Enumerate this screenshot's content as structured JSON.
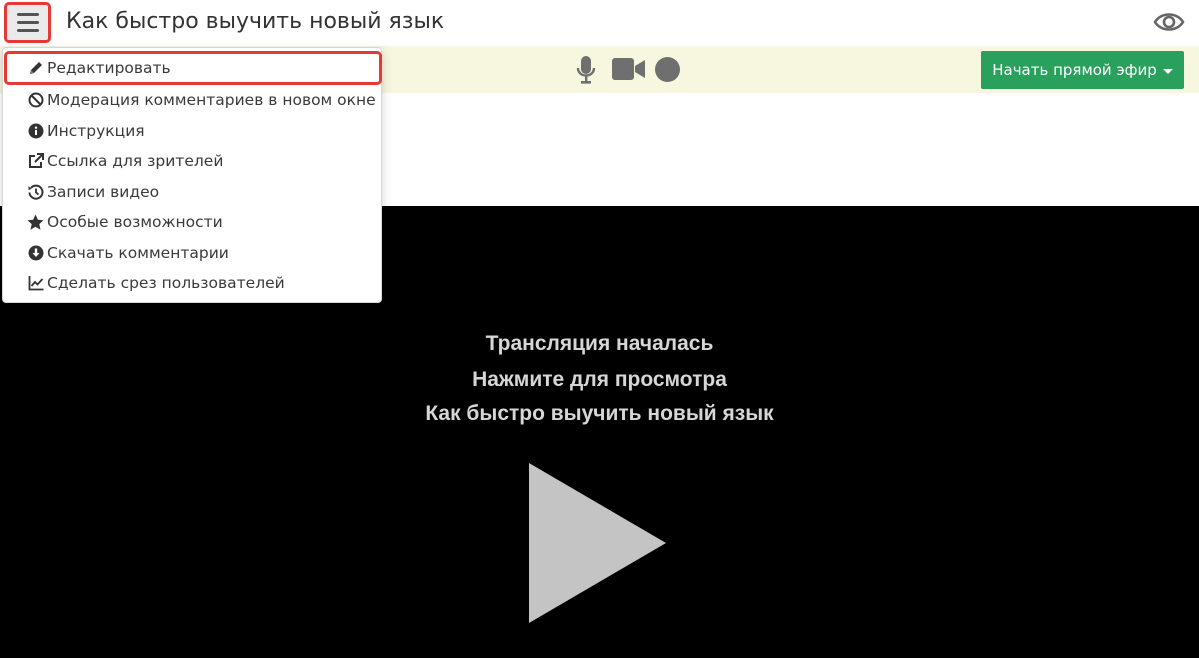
{
  "header": {
    "title": "Как быстро выучить новый язык"
  },
  "toolbar": {
    "live_button": "Начать прямой эфир"
  },
  "menu": {
    "items": [
      {
        "label": "Редактировать",
        "icon": "pencil-icon"
      },
      {
        "label": "Модерация комментариев в новом окне",
        "icon": "ban-icon"
      },
      {
        "label": "Инструкция",
        "icon": "info-icon"
      },
      {
        "label": "Ссылка для зрителей",
        "icon": "external-link-icon"
      },
      {
        "label": "Записи видео",
        "icon": "history-icon"
      },
      {
        "label": "Особые возможности",
        "icon": "star-icon"
      },
      {
        "label": "Скачать комментарии",
        "icon": "download-icon"
      },
      {
        "label": "Сделать срез пользователей",
        "icon": "line-chart-icon"
      }
    ]
  },
  "player": {
    "line1": "Трансляция началась",
    "line2": "Нажмите для просмотра",
    "line3": "Как быстро выучить новый язык"
  },
  "colors": {
    "accent_green": "#29a05c",
    "highlight_red": "#e53935",
    "toolbar_bg": "#f7f6de",
    "player_bg": "#000000"
  }
}
